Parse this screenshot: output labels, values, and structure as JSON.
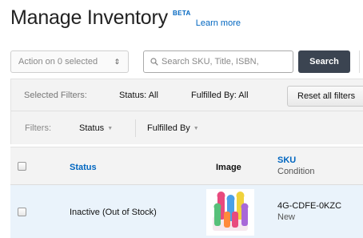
{
  "header": {
    "title": "Manage Inventory",
    "beta": "BETA",
    "learn_more": "Learn more"
  },
  "toolbar": {
    "action_select": "Action on 0 selected",
    "search_placeholder": "Search SKU, Title, ISBN,",
    "search_button": "Search"
  },
  "filters": {
    "selected_label": "Selected Filters:",
    "status_selected": "Status: All",
    "fulfilled_selected": "Fulfilled By: All",
    "reset_button": "Reset all filters",
    "filters_label": "Filters:",
    "status_dropdown": "Status",
    "fulfilled_dropdown": "Fulfilled By"
  },
  "table": {
    "columns": {
      "status": "Status",
      "image": "Image",
      "sku": "SKU",
      "condition": "Condition"
    },
    "rows": [
      {
        "status": "Inactive (Out of Stock)",
        "image_icon": "product-thumbnail",
        "sku": "4G-CDFE-0KZC",
        "condition": "New"
      }
    ]
  },
  "colors": {
    "link": "#0066c0",
    "search_button_bg": "#3b4451",
    "row_highlight": "#eaf3fb",
    "panel_bg": "#f3f3f3"
  }
}
